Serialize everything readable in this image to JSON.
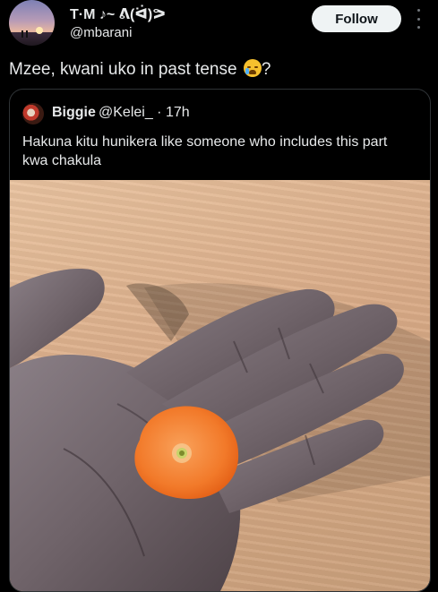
{
  "author": {
    "display_name": "T·M ♪~ ᕕ(ᐛ)ᕗ",
    "handle": "@mbarani",
    "avatar": "sunset-avatar"
  },
  "follow_label": "Follow",
  "more_icon": "more-vertical-icon",
  "tweet": {
    "text": "Mzee, kwani uko in past tense",
    "emoji": "crying-face-emoji",
    "suffix": "?"
  },
  "quoted": {
    "name": "Biggie",
    "handle": "@Kelei_",
    "time": "· 17h",
    "text": "Hakuna kitu hunikera like someone who includes this part kwa chakula",
    "image": "hand-holding-carrot-slice-photo"
  },
  "colors": {
    "background": "#000000",
    "text": "#e7e9ea",
    "follow_bg": "#eff3f4",
    "border": "#2f3336"
  }
}
